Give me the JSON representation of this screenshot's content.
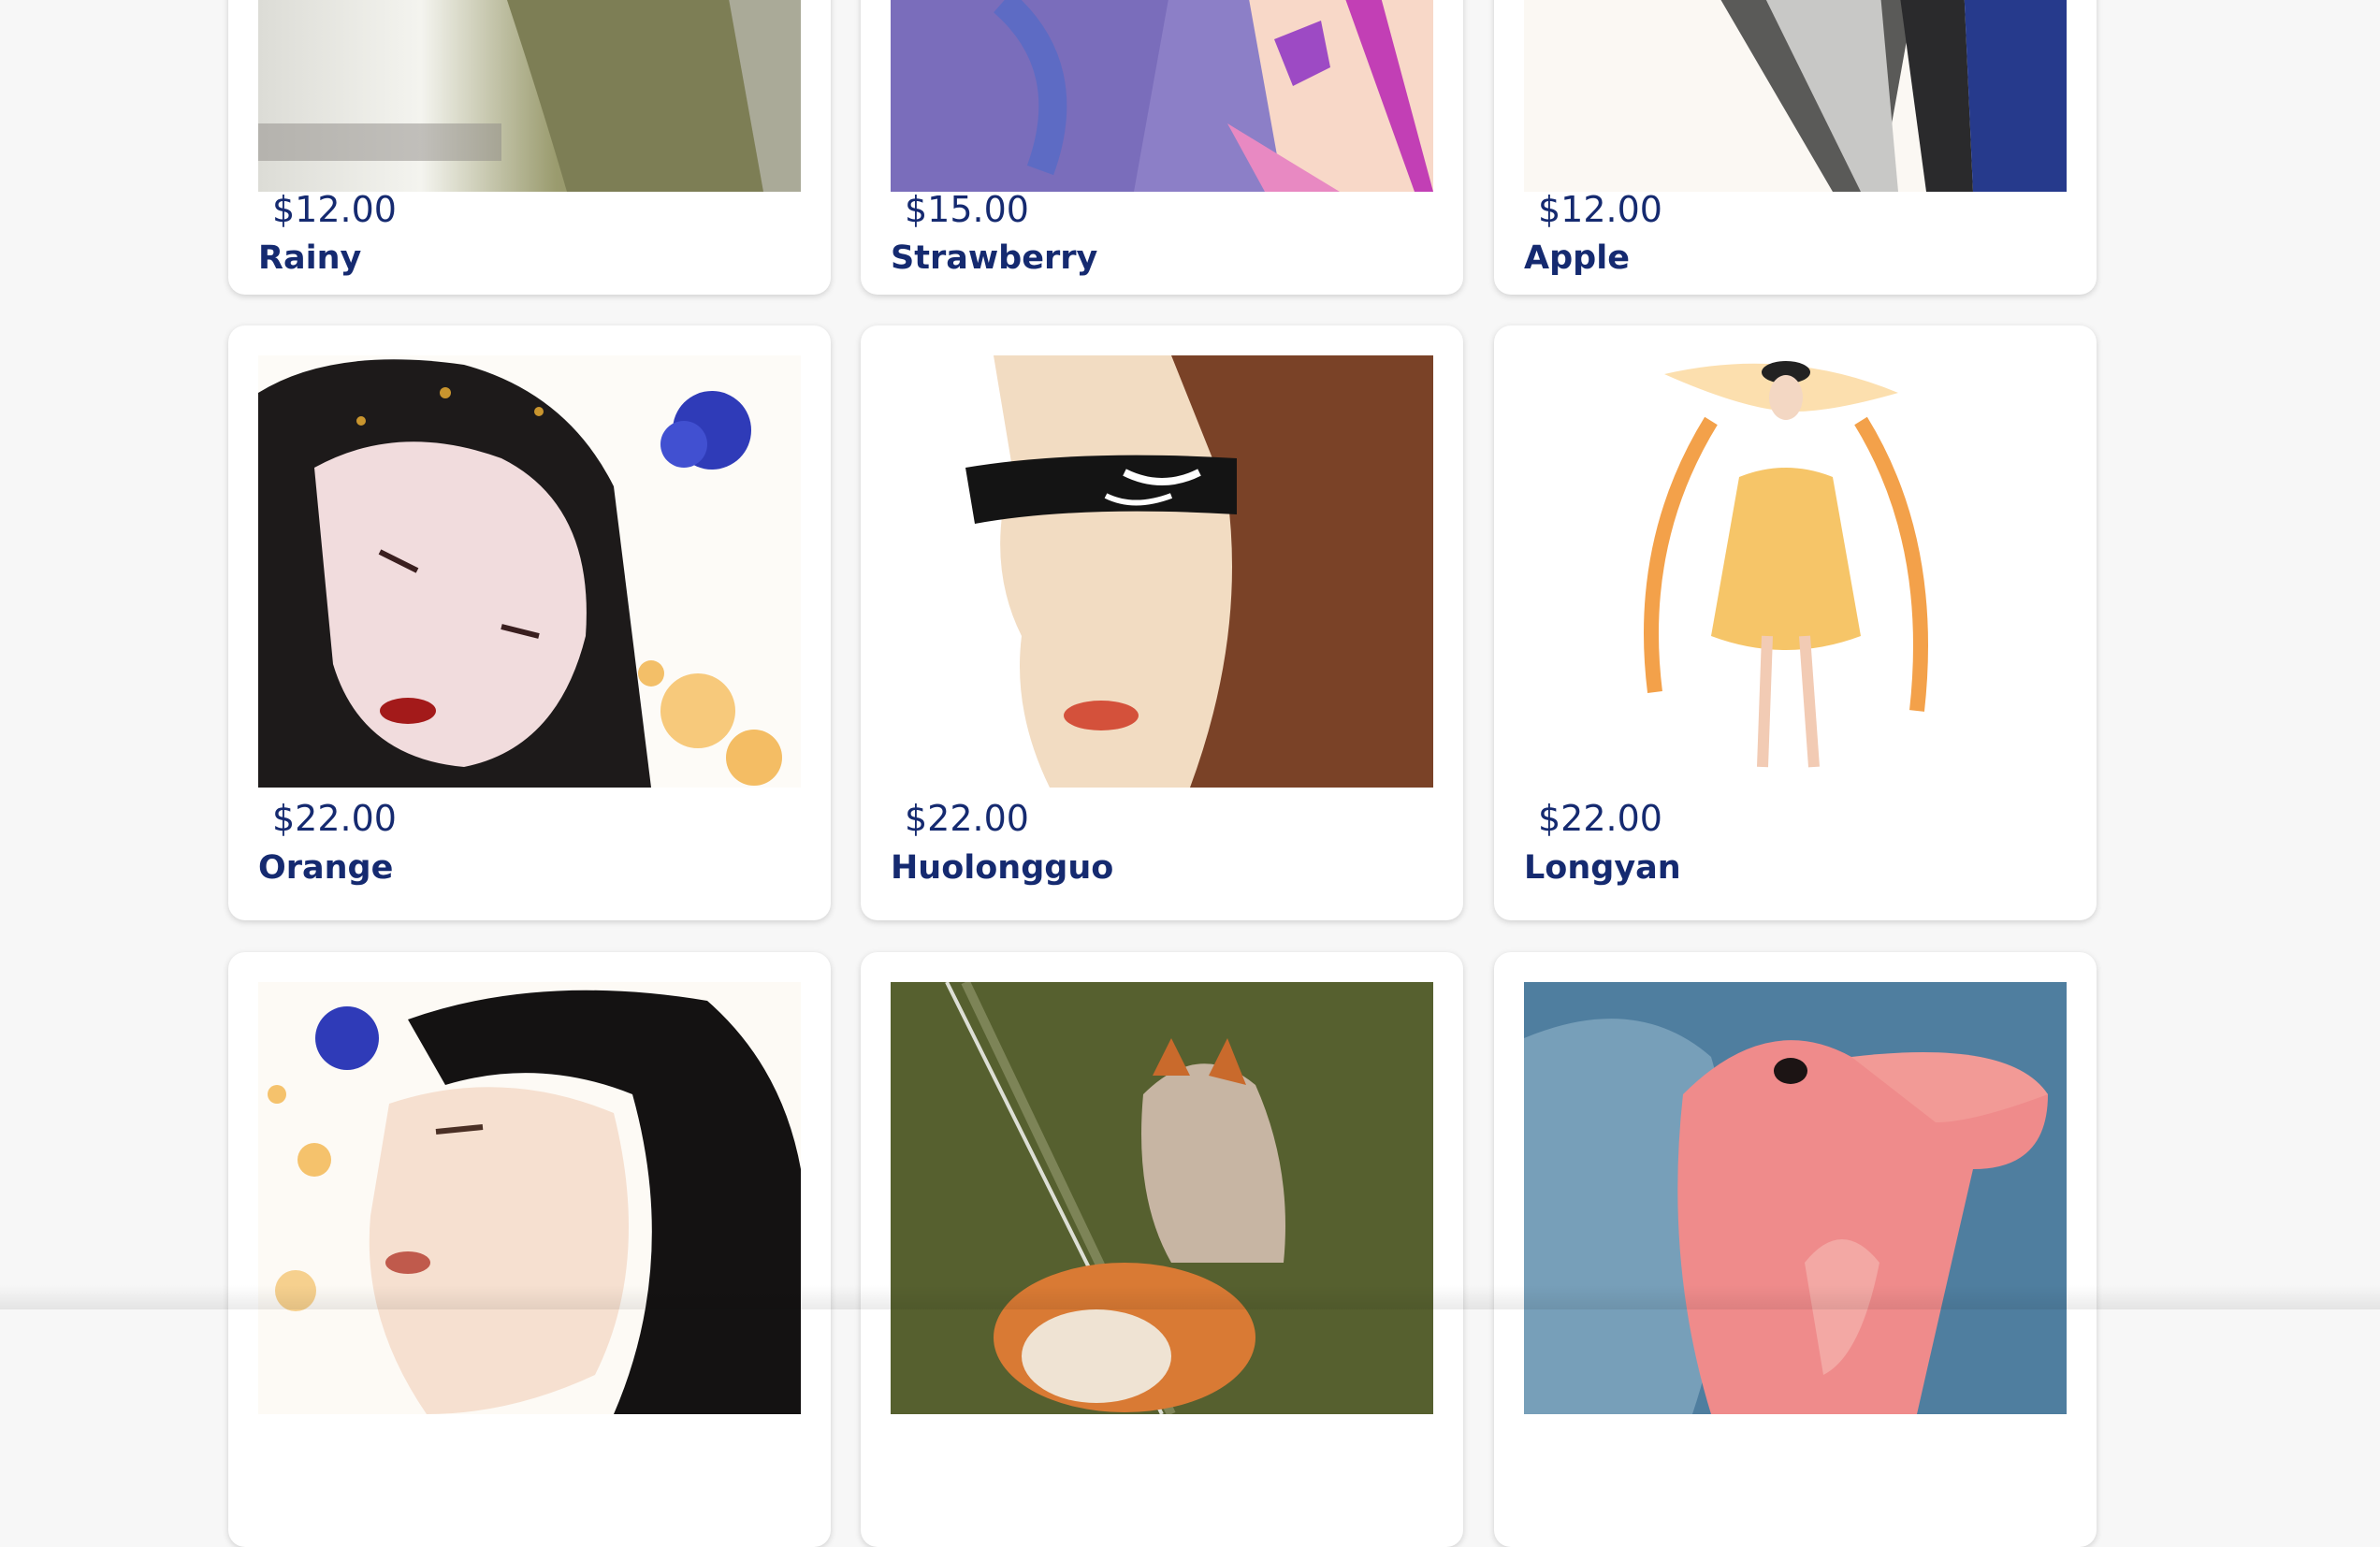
{
  "products": [
    {
      "title": "Rainy",
      "price": "$12.00",
      "image": "cat-painting"
    },
    {
      "title": "Strawberry",
      "price": "$15.00",
      "image": "abstract-purple-painting"
    },
    {
      "title": "Apple",
      "price": "$12.00",
      "image": "ink-robe-painting"
    },
    {
      "title": "Orange",
      "price": "$22.00",
      "image": "woman-dark-hair-painting"
    },
    {
      "title": "Huolongguo",
      "price": "$22.00",
      "image": "blindfolded-woman-painting"
    },
    {
      "title": "Longyan",
      "price": "$22.00",
      "image": "fairy-dancer-painting"
    },
    {
      "title": "",
      "price": "",
      "image": "man-portrait-painting"
    },
    {
      "title": "",
      "price": "",
      "image": "fox-painting"
    },
    {
      "title": "",
      "price": "",
      "image": "pink-bunny-painting"
    }
  ],
  "colors": {
    "text": "#152a70",
    "background": "#f7f7f7",
    "card": "#ffffff"
  }
}
